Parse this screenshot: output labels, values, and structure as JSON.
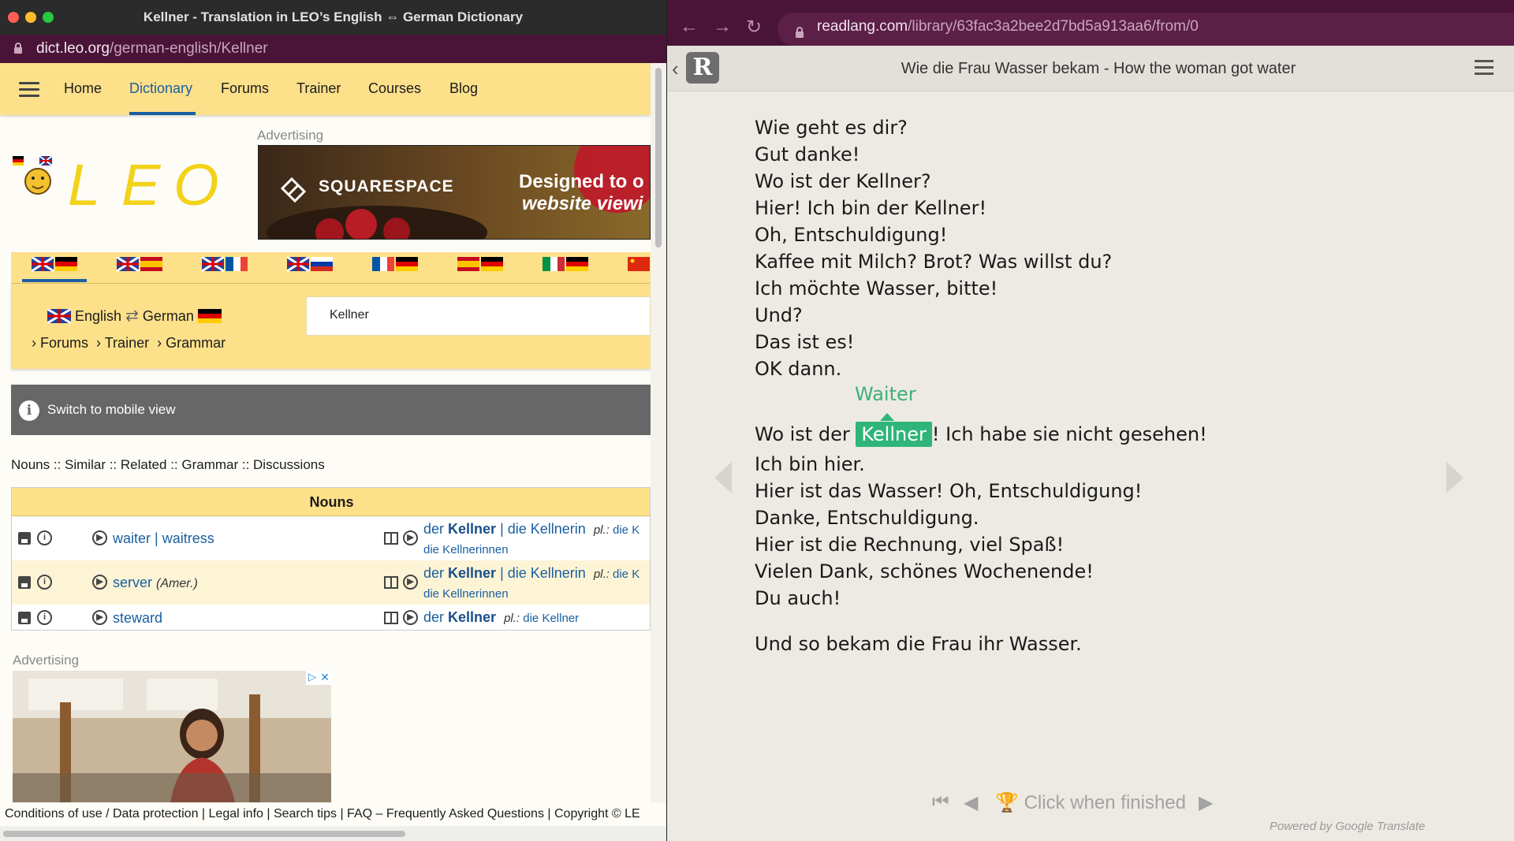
{
  "left_window": {
    "title": "Kellner - Translation in LEO’s English ⇔ German Dictionary",
    "url_host": "dict.leo.org",
    "url_path": "/german-english/Kellner",
    "nav": [
      "Home",
      "Dictionary",
      "Forums",
      "Trainer",
      "Courses",
      "Blog"
    ],
    "active_nav": "Dictionary",
    "logo_text": "LEO",
    "advertising_label": "Advertising",
    "banner": {
      "brand": "SQUARESPACE",
      "line1": "Designed to o",
      "line2": "website viewi"
    },
    "language_pairs": [
      "en-de",
      "en-es",
      "en-fr",
      "en-ru",
      "fr-de",
      "es-de",
      "it-de",
      "zh-de"
    ],
    "lang_switch": {
      "from": "English",
      "to": "German"
    },
    "search_value": "Kellner",
    "sublinks": [
      "Forums",
      "Trainer",
      "Grammar"
    ],
    "mobile_view": "Switch to mobile view",
    "section_links": "Nouns :: Similar :: Related :: Grammar :: Discussions",
    "table": {
      "header": "Nouns",
      "rows": [
        {
          "en": "waiter | waitress",
          "en_note": "",
          "de_article": "der",
          "de_word": "Kellner",
          "de_rest": " | die Kellnerin",
          "de_pl_label": "pl.:",
          "de_pl": " die K",
          "de_sub": "die Kellnerinnen"
        },
        {
          "en": "server",
          "en_note": "(Amer.)",
          "de_article": "der",
          "de_word": "Kellner",
          "de_rest": " | die Kellnerin",
          "de_pl_label": "pl.:",
          "de_pl": " die K",
          "de_sub": "die Kellnerinnen"
        },
        {
          "en": "steward",
          "en_note": "",
          "de_article": "der",
          "de_word": "Kellner",
          "de_rest": "",
          "de_pl_label": "pl.:",
          "de_pl": " die Kellner",
          "de_sub": ""
        }
      ]
    },
    "footer": "Conditions of use / Data protection | Legal info | Search tips | FAQ – Frequently Asked Questions | Copyright © LE"
  },
  "right_window": {
    "url_host": "readlang.com",
    "url_path": "/library/63fac3a2bee2d7bd5a913aa6/from/0",
    "logo": "R",
    "title": "Wie die Frau Wasser bekam - How the woman got water",
    "lines_before": [
      "Wie geht es dir?",
      "Gut danke!",
      "Wo ist der Kellner?",
      "Hier! Ich bin der Kellner!",
      "Oh, Entschuldigung!",
      "Kaffee mit Milch? Brot? Was willst du?",
      "Ich möchte Wasser, bitte!",
      "Und?",
      "Das ist es!",
      "OK dann."
    ],
    "translation_hint": "Waiter",
    "highlight_line": {
      "before": "Wo ist der ",
      "word": "Kellner",
      "after": "! Ich habe sie nicht gesehen!"
    },
    "lines_after": [
      "Ich bin hier.",
      "Hier ist das Wasser! Oh, Entschuldigung!",
      "Danke, Entschuldigung.",
      "Hier ist die Rechnung, viel Spaß!",
      "Vielen Dank, schönes Wochenende!",
      "Du auch!"
    ],
    "closing_line": "Und so bekam die Frau ihr Wasser.",
    "finish_label": "Click when finished",
    "powered_by": "Powered by Google Translate"
  },
  "colors": {
    "leo_yellow": "#fde08a",
    "leo_blue": "#1a5fa0",
    "browser_maroon": "#4a1438",
    "readlang_green": "#2fb57a"
  }
}
